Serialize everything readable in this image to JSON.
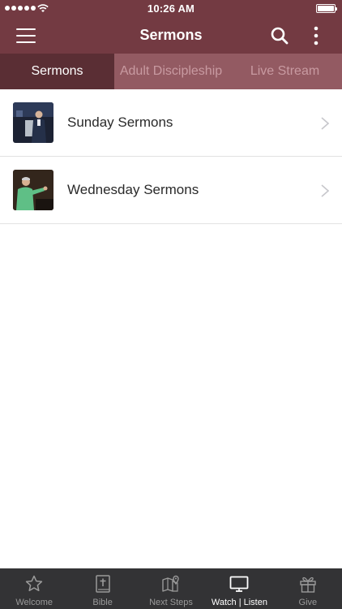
{
  "status": {
    "time": "10:26 AM"
  },
  "header": {
    "title": "Sermons",
    "menu_icon": "hamburger-menu-icon",
    "search_icon": "search-icon",
    "more_icon": "more-vertical-icon"
  },
  "tabs": [
    {
      "label": "Sermons",
      "active": true
    },
    {
      "label": "Adult Discipleship",
      "active": false
    },
    {
      "label": "Live Stream",
      "active": false
    }
  ],
  "list": {
    "items": [
      {
        "label": "Sunday Sermons"
      },
      {
        "label": "Wednesday Sermons"
      }
    ]
  },
  "tabbar": {
    "items": [
      {
        "label": "Welcome",
        "icon": "star-icon",
        "active": false
      },
      {
        "label": "Bible",
        "icon": "bible-icon",
        "active": false
      },
      {
        "label": "Next Steps",
        "icon": "map-pin-icon",
        "active": false
      },
      {
        "label": "Watch | Listen",
        "icon": "tv-icon",
        "active": true
      },
      {
        "label": "Give",
        "icon": "gift-icon",
        "active": false
      }
    ]
  },
  "colors": {
    "accent": "#733a42",
    "tab_bg": "#935a62",
    "tab_active": "#5a2e34",
    "tabbar_bg": "#333335"
  }
}
